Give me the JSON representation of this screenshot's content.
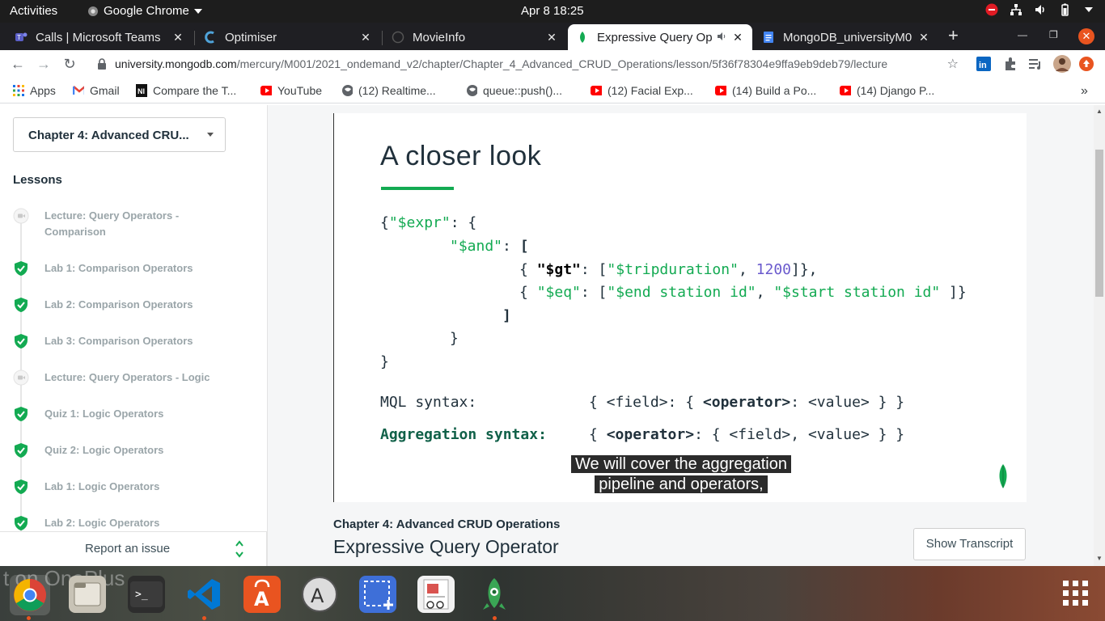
{
  "topbar": {
    "activities": "Activities",
    "app_menu": "Google Chrome",
    "clock": "Apr 8  18:25"
  },
  "tabs": [
    {
      "title": "Calls | Microsoft Teams",
      "icon": "teams-icon"
    },
    {
      "title": "Optimiser",
      "icon": "optimiser-icon"
    },
    {
      "title": "MovieInfo",
      "icon": "globe-icon"
    },
    {
      "title": "Expressive Query Op",
      "icon": "mongodb-leaf-icon",
      "active": true
    },
    {
      "title": "MongoDB_universityM0",
      "icon": "google-docs-icon"
    }
  ],
  "toolbar": {
    "url_host": "university.mongodb.com",
    "url_path": "/mercury/M001/2021_ondemand_v2/chapter/Chapter_4_Advanced_CRUD_Operations/lesson/5f36f78304e9ffa9eb9deb79/lecture"
  },
  "bookmarks": [
    {
      "label": "Apps",
      "icon": "apps-grid-icon"
    },
    {
      "label": "Gmail",
      "icon": "gmail-icon"
    },
    {
      "label": "Compare the T...",
      "icon": "compare-icon"
    },
    {
      "label": "YouTube",
      "icon": "youtube-icon"
    },
    {
      "label": "(12) Realtime...",
      "icon": "globe-icon"
    },
    {
      "label": "queue::push()...",
      "icon": "globe-icon"
    },
    {
      "label": "(12) Facial Exp...",
      "icon": "youtube-icon"
    },
    {
      "label": "(14) Build a Po...",
      "icon": "youtube-icon"
    },
    {
      "label": "(14) Django P...",
      "icon": "youtube-icon"
    }
  ],
  "sidebar": {
    "chapter_select": "Chapter 4: Advanced CRU...",
    "lessons_heading": "Lessons",
    "lessons": [
      {
        "label": "Lecture: Query Operators - Comparison",
        "status": "video"
      },
      {
        "label": "Lab 1: Comparison Operators",
        "status": "complete"
      },
      {
        "label": "Lab 2: Comparison Operators",
        "status": "complete"
      },
      {
        "label": "Lab 3: Comparison Operators",
        "status": "complete"
      },
      {
        "label": "Lecture: Query Operators - Logic",
        "status": "video"
      },
      {
        "label": "Quiz 1: Logic Operators",
        "status": "complete"
      },
      {
        "label": "Quiz 2: Logic Operators",
        "status": "complete"
      },
      {
        "label": "Lab 1: Logic Operators",
        "status": "complete"
      },
      {
        "label": "Lab 2: Logic Operators",
        "status": "complete"
      }
    ],
    "report_issue": "Report an issue"
  },
  "slide": {
    "title": "A closer look",
    "mql_label": "MQL syntax:",
    "agg_label": "Aggregation syntax:",
    "caption_line1": "We will cover the aggregation",
    "caption_line2": "pipeline and operators,"
  },
  "lecture": {
    "chapter": "Chapter 4: Advanced CRUD Operations",
    "title": "Expressive Query Operator",
    "show_transcript": "Show Transcript"
  },
  "dock": {
    "wallpaper_text": "t on OnePlus"
  },
  "colors": {
    "mongo_green": "#13aa52",
    "dark_text": "#21313c",
    "topbar": "#1d1d1d",
    "tabstrip": "#1f1f23"
  }
}
